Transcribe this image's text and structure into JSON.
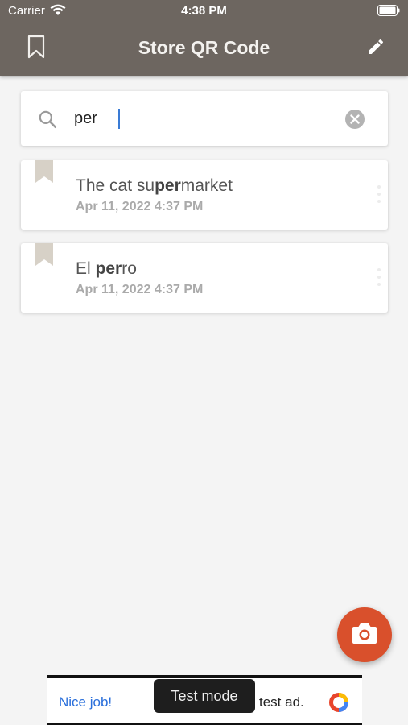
{
  "status_bar": {
    "carrier": "Carrier",
    "time": "4:38 PM"
  },
  "app_bar": {
    "title": "Store QR Code",
    "left_icon": "bookmark-outline-icon",
    "right_icon": "pencil-edit-icon",
    "background": "#6d6660"
  },
  "search": {
    "value": "per",
    "icon": "search-icon",
    "clear_icon": "clear-circle-icon"
  },
  "results": [
    {
      "title_before": "The cat su",
      "title_match": "per",
      "title_after": "market",
      "date": "Apr 11, 2022 4:37 PM"
    },
    {
      "title_before": "El ",
      "title_match": "per",
      "title_after": "ro",
      "date": "Apr 11, 2022 4:37 PM"
    }
  ],
  "fab": {
    "icon": "camera-icon",
    "color": "#d9502c"
  },
  "ad": {
    "left_text": "Nice job!",
    "toast": "Test mode",
    "right_text": "test ad."
  }
}
